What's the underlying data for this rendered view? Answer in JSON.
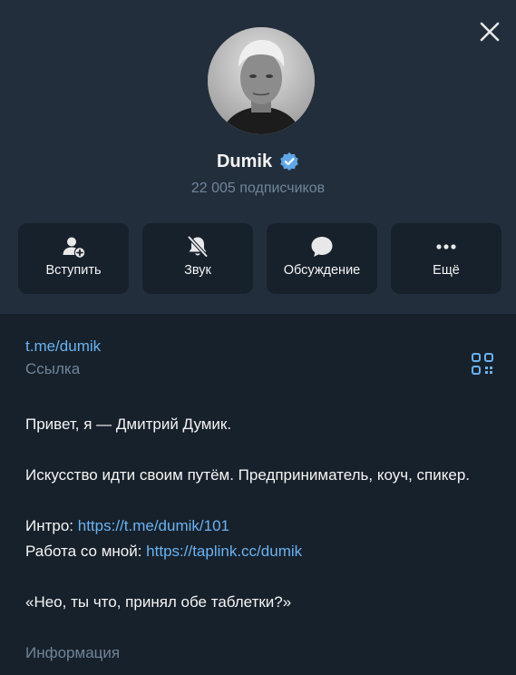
{
  "profile": {
    "name": "Dumik",
    "subscribers": "22 005 подписчиков"
  },
  "actions": [
    {
      "label": "Вступить",
      "icon": "add-user-icon"
    },
    {
      "label": "Звук",
      "icon": "bell-off-icon"
    },
    {
      "label": "Обсуждение",
      "icon": "chat-bubble-icon"
    },
    {
      "label": "Ещё",
      "icon": "more-dots-icon"
    }
  ],
  "link": {
    "url": "t.me/dumik",
    "caption": "Ссылка"
  },
  "bio": {
    "line1": "Привет, я — Дмитрий Думик.",
    "line2": "Искусство идти своим путём. Предприниматель, коуч, спикер.",
    "intro_label": "Интро: ",
    "intro_url": "https://t.me/dumik/101",
    "work_label": "Работа со мной: ",
    "work_url": "https://taplink.cc/dumik",
    "quote": "«Нео, ты что, принял обе таблетки?»",
    "caption": "Информация"
  },
  "colors": {
    "header_bg": "#232e3c",
    "page_bg": "#17212b",
    "accent": "#6ab3f3",
    "muted": "#708499",
    "verified": "#5fa7e6"
  }
}
